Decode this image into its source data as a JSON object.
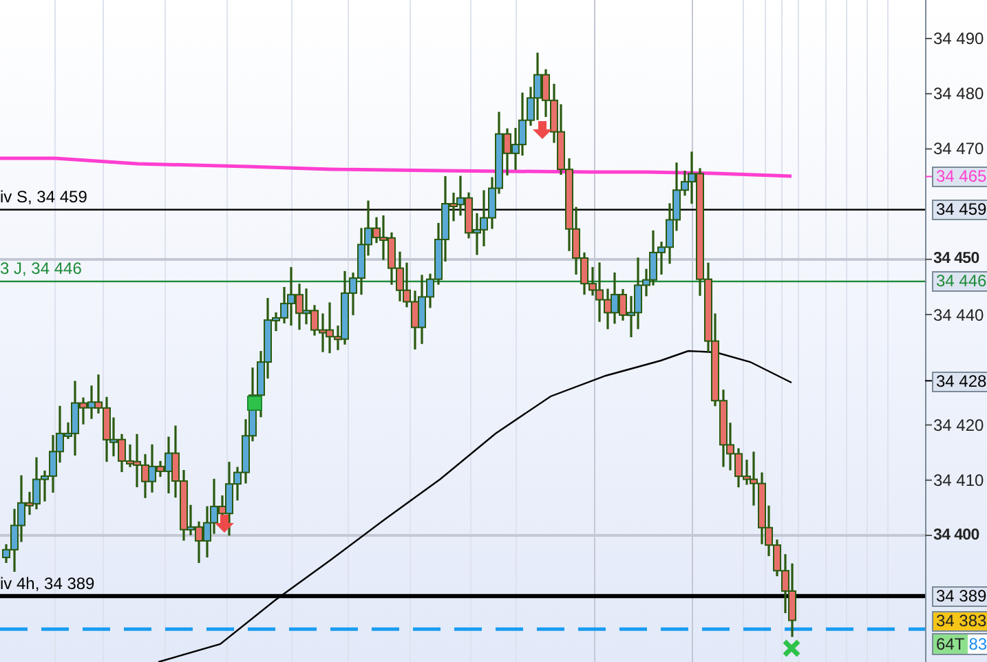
{
  "price_axis": {
    "ticks": [
      {
        "label": "34 490",
        "bold": false
      },
      {
        "label": "34 480",
        "bold": false
      },
      {
        "label": "34 470",
        "bold": false
      },
      {
        "label": "34 450",
        "bold": true
      },
      {
        "label": "34 440",
        "bold": false
      },
      {
        "label": "34 420",
        "bold": false
      },
      {
        "label": "34 410",
        "bold": false
      },
      {
        "label": "34 400",
        "bold": true
      }
    ]
  },
  "levels": [
    {
      "label": "iv S, 34 459",
      "tag": "34 459",
      "color": "#000000",
      "thick": false
    },
    {
      "label": "3 J, 34 446",
      "tag": "34 446",
      "color": "#1e8c3a",
      "thick": false
    },
    {
      "label": "iv 4h, 34 389",
      "tag": "34 389",
      "color": "#000000",
      "thick": true
    }
  ],
  "indicator_tags": [
    {
      "tag": "34 465",
      "color": "#ff3fd0"
    },
    {
      "tag": "34 428",
      "color": "#000000"
    }
  ],
  "last_price": {
    "tag": "34 383",
    "ticks_label": "64T",
    "seconds": "83"
  }
}
